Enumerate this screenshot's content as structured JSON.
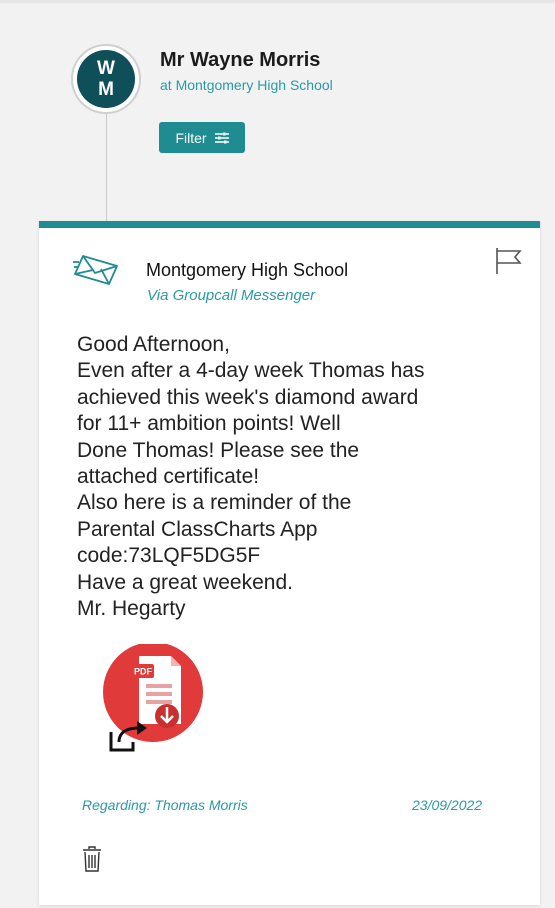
{
  "header": {
    "avatar_initials_line1": "W",
    "avatar_initials_line2": "M",
    "sender_name": "Mr Wayne Morris",
    "sender_org": "at Montgomery High School",
    "filter_label": "Filter",
    "filter_icon": "sliders-icon"
  },
  "message_card": {
    "school_name": "Montgomery High School",
    "via": "Via Groupcall Messenger",
    "lines": [
      "Good Afternoon,",
      "Even after a 4-day week Thomas has",
      "achieved this week's diamond award",
      "for 11+ ambition points! Well",
      "Done Thomas! Please see the",
      "attached certificate!",
      "Also here is a reminder of the",
      "Parental ClassCharts App",
      "code:73LQF5DG5F",
      "Have a great weekend.",
      "Mr. Hegarty"
    ],
    "attachment": {
      "type_label": "PDF",
      "icon": "pdf-download-icon"
    },
    "regarding": "Regarding: Thomas Morris",
    "date": "23/09/2022"
  },
  "colors": {
    "accent": "#1e8c91",
    "avatar_bg": "#0f4f59",
    "link_text": "#2a9aa3",
    "pdf_red": "#e03a3a"
  }
}
